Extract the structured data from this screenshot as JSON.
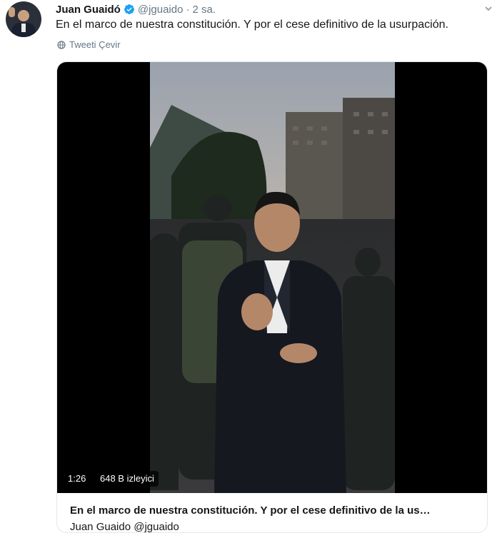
{
  "tweet": {
    "author_name": "Juan Guaidó",
    "handle": "@jguaido",
    "separator": "·",
    "time": "2 sa.",
    "text": "En el marco de nuestra constitución. Y por el cese definitivo de la usurpación.",
    "translate_label": "Tweeti Çevir"
  },
  "media": {
    "duration": "1:26",
    "views": "648 B izleyici",
    "card_title": "En el marco de nuestra constitución. Y por el cese definitivo de la us…",
    "card_author": "Juan Guaido @jguaido"
  },
  "colors": {
    "verified": "#1da1f2",
    "secondary_text": "#657786",
    "video_background": "#000000"
  },
  "icons": {
    "verified": "verified-badge-icon",
    "translate": "globe-icon",
    "menu": "chevron-down-icon"
  }
}
